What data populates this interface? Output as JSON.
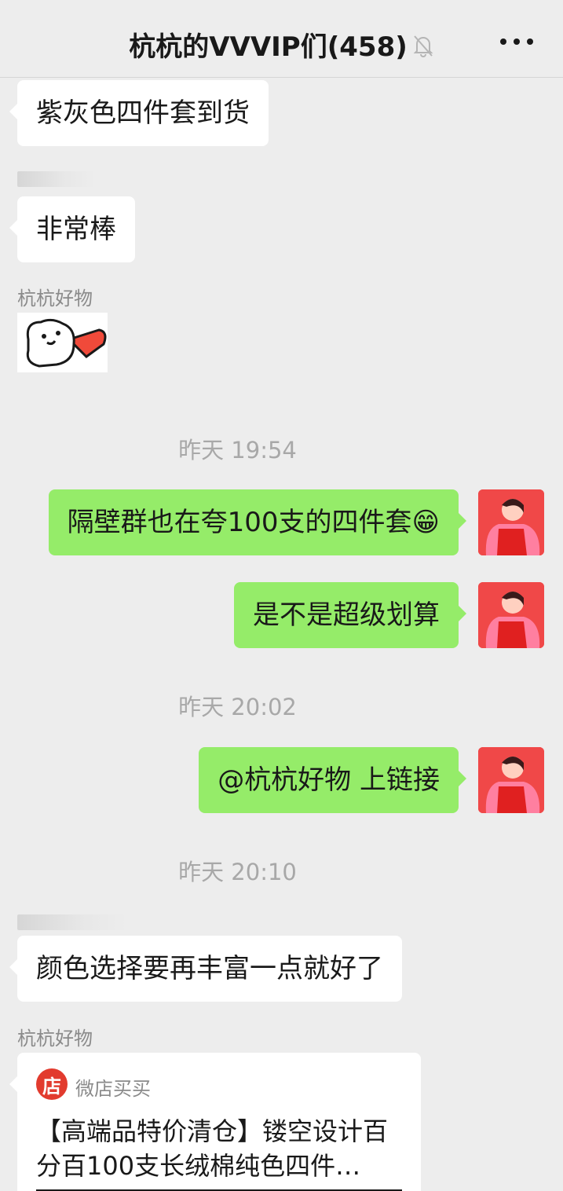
{
  "header": {
    "title": "杭杭的VVVIP们(458)",
    "mute_icon": "bell-muted-icon",
    "more_icon": "more-dots-icon"
  },
  "messages": [
    {
      "type": "text",
      "side": "left",
      "text": "紫灰色四件套到货"
    },
    {
      "type": "text",
      "side": "left",
      "text": "非常棒"
    },
    {
      "type": "sticker",
      "side": "left",
      "sender": "杭杭好物",
      "sticker_icon": "flying-cat-sticker"
    },
    {
      "type": "time",
      "text": "昨天 19:54"
    },
    {
      "type": "text",
      "side": "right",
      "text": "隔壁群也在夸100支的四件套😁"
    },
    {
      "type": "text",
      "side": "right",
      "text": "是不是超级划算"
    },
    {
      "type": "time",
      "text": "昨天 20:02"
    },
    {
      "type": "text",
      "side": "right",
      "text": "@杭杭好物 上链接"
    },
    {
      "type": "time",
      "text": "昨天 20:10"
    },
    {
      "type": "text",
      "side": "left",
      "text": "颜色选择要再丰富一点就好了"
    },
    {
      "type": "link",
      "side": "left",
      "sender": "杭杭好物",
      "shop_logo_text": "店",
      "shop_name": "微店买买",
      "title": "【高端品特价清仓】镂空设计百分百100支长绒棉纯色四件…"
    }
  ],
  "colors": {
    "background": "#ededed",
    "bubble_self": "#95ec69",
    "bubble_other": "#ffffff",
    "avatar_red": "#f04848"
  }
}
